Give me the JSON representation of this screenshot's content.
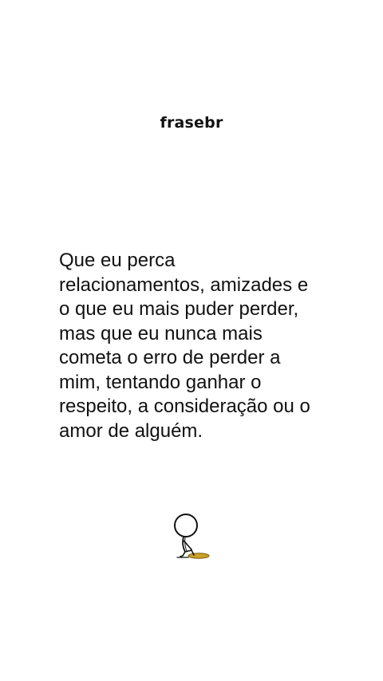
{
  "brand": {
    "name": "frasebr"
  },
  "quote": {
    "lines": [
      "Que eu perca",
      "relacionamentos, amizades e",
      "o que eu mais puder perder,",
      "mas que eu nunca mais",
      "cometa o erro de perder a",
      "mim, tentando ganhar o",
      "respeito, a consideração ou o",
      "amor de alguém."
    ]
  },
  "illustration": {
    "icon": "stick-figure-sitting-at-hole-icon",
    "colors": {
      "outline": "#111111",
      "hole": "#c9a227"
    }
  }
}
